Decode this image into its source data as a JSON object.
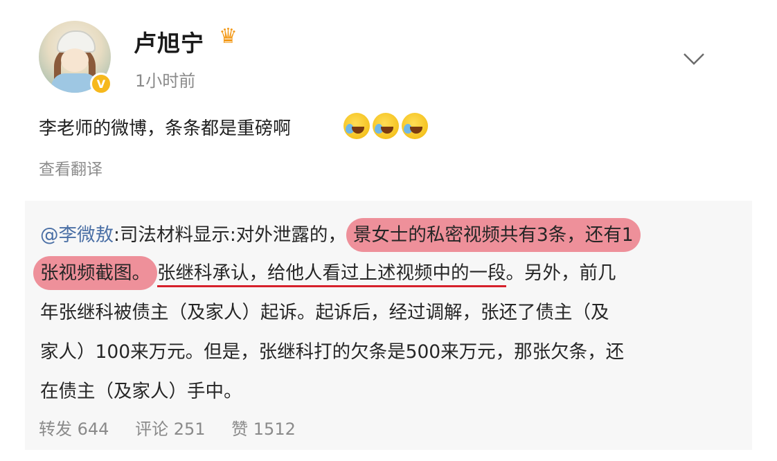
{
  "post": {
    "username": "卢旭宁",
    "time": "1小时前",
    "text": "李老师的微博，条条都是重磅啊",
    "translate": "查看翻译",
    "emojis": [
      "laugh-cry-icon",
      "laugh-cry-icon",
      "laugh-cry-icon"
    ]
  },
  "repost": {
    "mention": "@李微敖",
    "line1_a": ":司法材料显示:对外泄露的，",
    "line1_hl": "景女士的私密视频共有3条，还有1",
    "line2_hl": "张视频截图。",
    "line2_ul": "张继科承认，给他人看过上述视频中的一段",
    "line2_end": "。另外，前几",
    "line3": "年张继科被债主（及家人）起诉。起诉后，经过调解，张还了债主（及",
    "line4": "家人）100来万元。但是，张继科打的欠条是500来万元，那张欠条，还",
    "line5": "在债主（及家人）手中。"
  },
  "stats": {
    "forward": "转发 644",
    "comment": "评论 251",
    "like": "赞 1512"
  },
  "colors": {
    "highlight": "#ec7e8a",
    "underline": "#d6202b",
    "mention": "#4a6fa5",
    "crown": "#f39a1a",
    "badge": "#f6b81d"
  }
}
